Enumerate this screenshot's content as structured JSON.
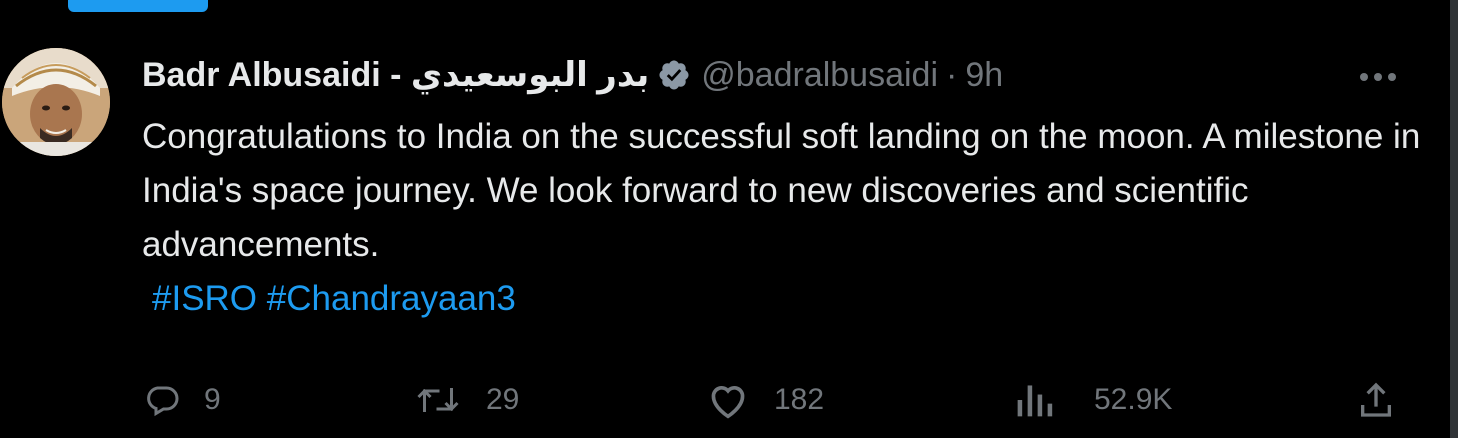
{
  "header": {
    "display_name": "Badr Albusaidi - بدر البوسعيدي",
    "handle": "@badralbusaidi",
    "separator": "·",
    "time": "9h"
  },
  "tweet": {
    "text": "Congratulations to India on the successful soft landing on the moon. A milestone in India's space journey. We look forward to new discoveries and scientific advancements.",
    "hashtags": [
      "#ISRO",
      "#Chandrayaan3"
    ]
  },
  "actions": {
    "replies": "9",
    "retweets": "29",
    "likes": "182",
    "views": "52.9K"
  },
  "colors": {
    "background": "#000000",
    "text": "#e7e9ea",
    "secondary": "#71767b",
    "accent": "#1d9bf0",
    "verified_badge": "#8b98a5"
  },
  "icons": {
    "verified": "verified-badge-icon",
    "more": "more-horizontal-icon",
    "reply": "reply-icon",
    "retweet": "retweet-icon",
    "like": "heart-icon",
    "views": "views-chart-icon",
    "share": "share-icon"
  }
}
